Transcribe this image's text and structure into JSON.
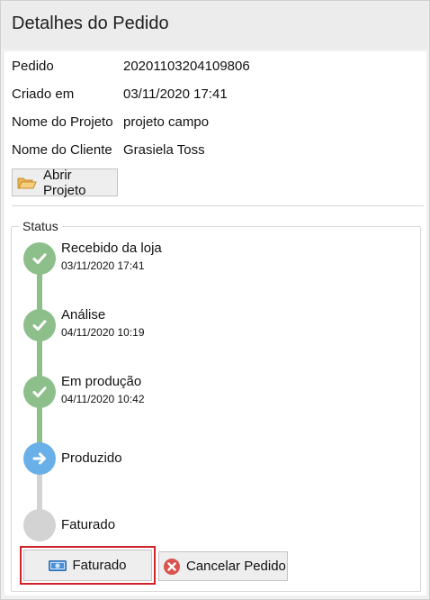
{
  "header": {
    "title": "Detalhes do Pedido"
  },
  "details": {
    "rows": [
      {
        "label": "Pedido",
        "value": "20201103204109806"
      },
      {
        "label": "Criado em",
        "value": "03/11/2020 17:41"
      },
      {
        "label": "Nome do Projeto",
        "value": "projeto campo"
      },
      {
        "label": "Nome do Cliente",
        "value": "Grasiela Toss"
      }
    ],
    "open_project_label": "Abrir Projeto"
  },
  "status": {
    "title": "Status",
    "steps": [
      {
        "label": "Recebido da loja",
        "date": "03/11/2020 17:41",
        "state": "done"
      },
      {
        "label": "Análise",
        "date": "04/11/2020 10:19",
        "state": "done"
      },
      {
        "label": "Em produção",
        "date": "04/11/2020 10:42",
        "state": "done"
      },
      {
        "label": "Produzido",
        "date": "",
        "state": "current"
      },
      {
        "label": "Faturado",
        "date": "",
        "state": "pending"
      }
    ]
  },
  "actions": {
    "invoice_label": "Faturado",
    "cancel_label": "Cancelar Pedido"
  },
  "colors": {
    "done": "#8dbf8b",
    "current": "#6ab0e8",
    "pending": "#d3d3d3",
    "highlight": "#d0212a",
    "cancel": "#d9534f"
  },
  "icons": {
    "open_project": "folder-icon",
    "invoice": "banknote-icon",
    "cancel": "cancel-circle-icon",
    "done": "check-icon",
    "current": "arrow-right-icon"
  }
}
